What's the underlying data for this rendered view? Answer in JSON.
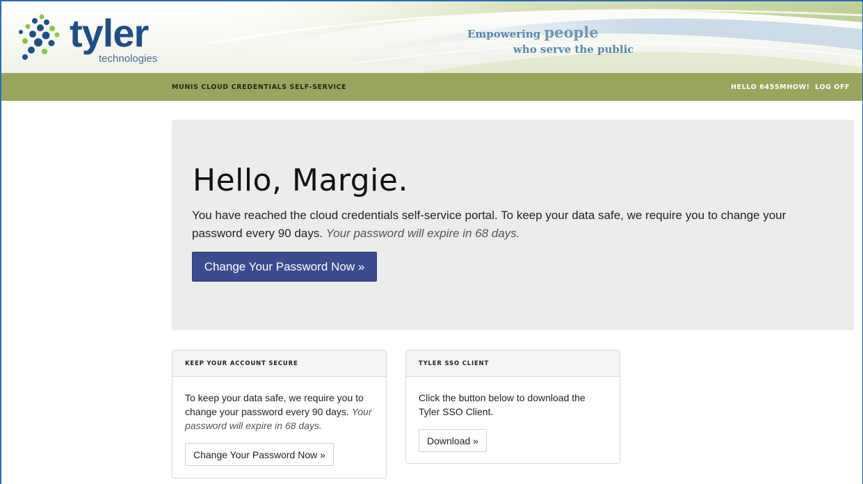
{
  "header": {
    "logo_word": "tyler",
    "logo_sub": "technologies",
    "tagline_prefix": "Empowering ",
    "tagline_emphasis": "people",
    "tagline_line2": "who serve the public",
    "brand_color": "#1f4e86"
  },
  "navbar": {
    "title": "MUNIS CLOUD CREDENTIALS SELF-SERVICE",
    "greeting": "HELLO 645SMHOW!",
    "logoff": "LOG OFF",
    "color": "#9aa45e"
  },
  "jumbotron": {
    "heading": "Hello, Margie.",
    "text": "You have reached the cloud credentials self-service portal. To keep your data safe, we require you to change your password every 90 days.",
    "expiry": "Your password will expire in 68 days.",
    "button": "Change Your Password Now »",
    "button_color": "#3b4b8c"
  },
  "panels": [
    {
      "title": "KEEP YOUR ACCOUNT SECURE",
      "text": "To keep your data safe, we require you to change your password every 90 days.",
      "expiry": "Your password will expire in 68 days.",
      "button": "Change Your Password Now »"
    },
    {
      "title": "TYLER SSO CLIENT",
      "text": "Click the button below to download the Tyler SSO Client.",
      "button": "Download »"
    }
  ]
}
